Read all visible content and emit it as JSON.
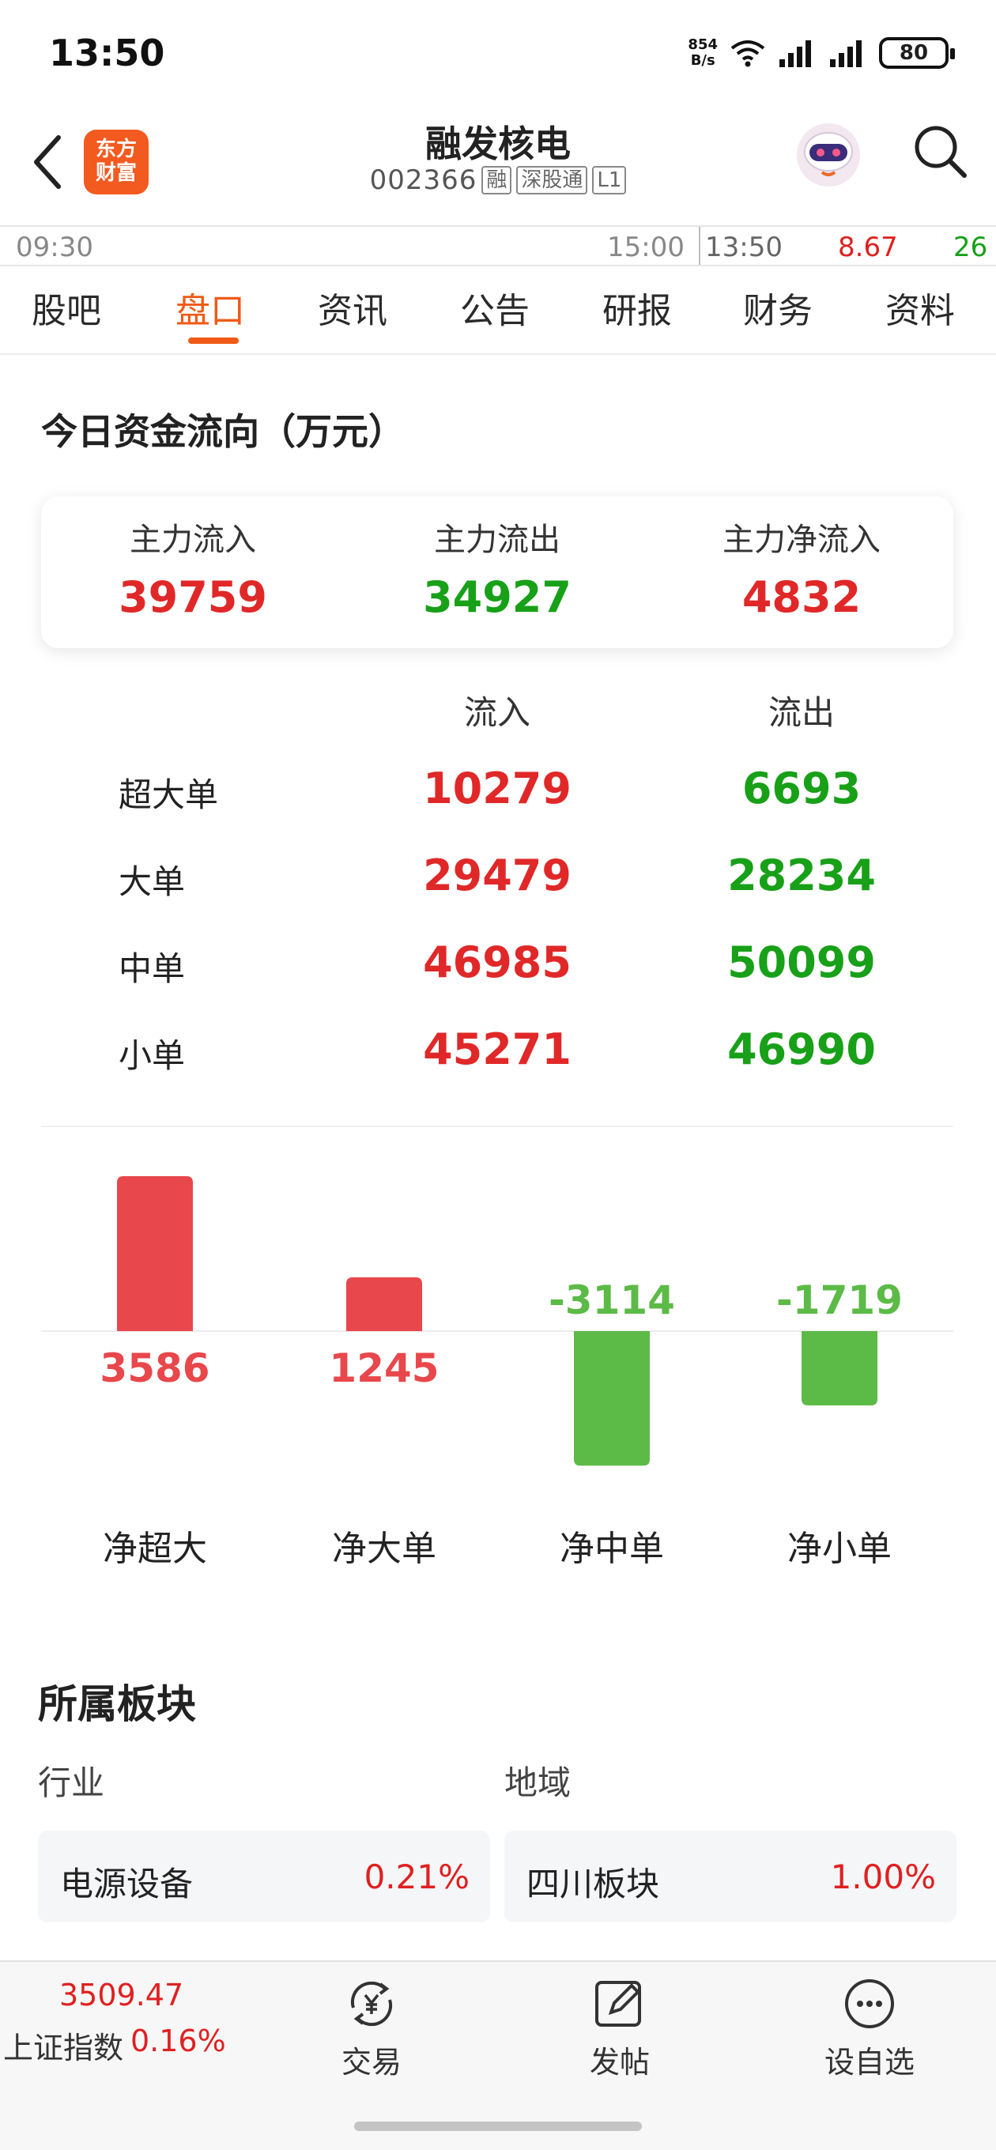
{
  "status_bar": {
    "time": "13:50",
    "net_speed_value": "854",
    "net_speed_unit": "B/s",
    "battery": "80"
  },
  "header": {
    "back_icon": "chevron-left-icon",
    "logo_line1": "东方",
    "logo_line2": "财富",
    "stock_name": "融发核电",
    "stock_code": "002366",
    "tags": [
      "融",
      "深股通",
      "L1"
    ]
  },
  "ticker": {
    "open_time": "09:30",
    "close_time": "15:00",
    "current_time": "13:50",
    "price": "8.67",
    "volume": "26"
  },
  "tabs": [
    {
      "label": "股吧",
      "active": false
    },
    {
      "label": "盘口",
      "active": true
    },
    {
      "label": "资讯",
      "active": false
    },
    {
      "label": "公告",
      "active": false
    },
    {
      "label": "研报",
      "active": false
    },
    {
      "label": "财务",
      "active": false
    },
    {
      "label": "资料",
      "active": false
    }
  ],
  "fund_flow": {
    "title": "今日资金流向（万元）",
    "summary": [
      {
        "label": "主力流入",
        "value": "39759",
        "color": "#e02828"
      },
      {
        "label": "主力流出",
        "value": "34927",
        "color": "#18a018"
      },
      {
        "label": "主力净流入",
        "value": "4832",
        "color": "#e02828"
      }
    ],
    "columns": [
      "流入",
      "流出"
    ],
    "rows": [
      {
        "label": "超大单",
        "inflow": "10279",
        "outflow": "6693"
      },
      {
        "label": "大单",
        "inflow": "29479",
        "outflow": "28234"
      },
      {
        "label": "中单",
        "inflow": "46985",
        "outflow": "50099"
      },
      {
        "label": "小单",
        "inflow": "45271",
        "outflow": "46990"
      }
    ]
  },
  "chart_data": {
    "type": "bar",
    "categories": [
      "净超大",
      "净大单",
      "净中单",
      "净小单"
    ],
    "values": [
      3586,
      1245,
      -3114,
      -1719
    ],
    "positive_color": "#e8474b",
    "negative_color": "#5cba47"
  },
  "sectors": {
    "title": "所属板块",
    "groups": [
      {
        "label": "行业",
        "name": "电源设备",
        "change": "0.21%"
      },
      {
        "label": "地域",
        "name": "四川板块",
        "change": "1.00%"
      }
    ]
  },
  "bottom_bar": {
    "index_value": "3509.47",
    "index_name": "上证指数",
    "index_change": "0.16%",
    "items": [
      {
        "label": "交易",
        "icon": "trade-yen-icon"
      },
      {
        "label": "发帖",
        "icon": "compose-icon"
      },
      {
        "label": "设自选",
        "icon": "more-dots-icon"
      }
    ]
  }
}
